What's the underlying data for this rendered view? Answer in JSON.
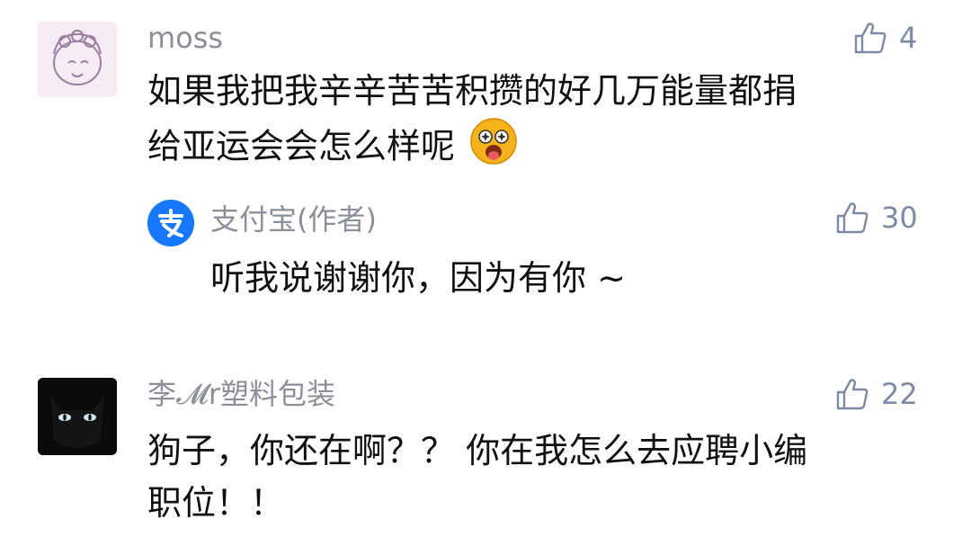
{
  "comments": [
    {
      "user": "moss",
      "text_line1": "如果我把我辛辛苦苦积攒的好几万能量都捐",
      "text_line2": "给亚运会会怎么样呢",
      "likes": "4",
      "reply": {
        "user": "支付宝(作者)",
        "text": "听我说谢谢你，因为有你 ~",
        "likes": "30"
      }
    },
    {
      "user": "李𝓜r塑料包装",
      "text_line1": "狗子，你还在啊？？ 你在我怎么去应聘小编",
      "text_line2": "职位！！",
      "likes": "22"
    }
  ],
  "colors": {
    "name": "#8a8f99",
    "text": "#111111",
    "like": "#7d8aa6",
    "alipay_blue": "#1677ff"
  },
  "icons": {
    "like": "thumbs-up-outline-icon",
    "emoji": "starstruck-tongue-emoji-icon",
    "alipay": "alipay-logo-icon"
  }
}
